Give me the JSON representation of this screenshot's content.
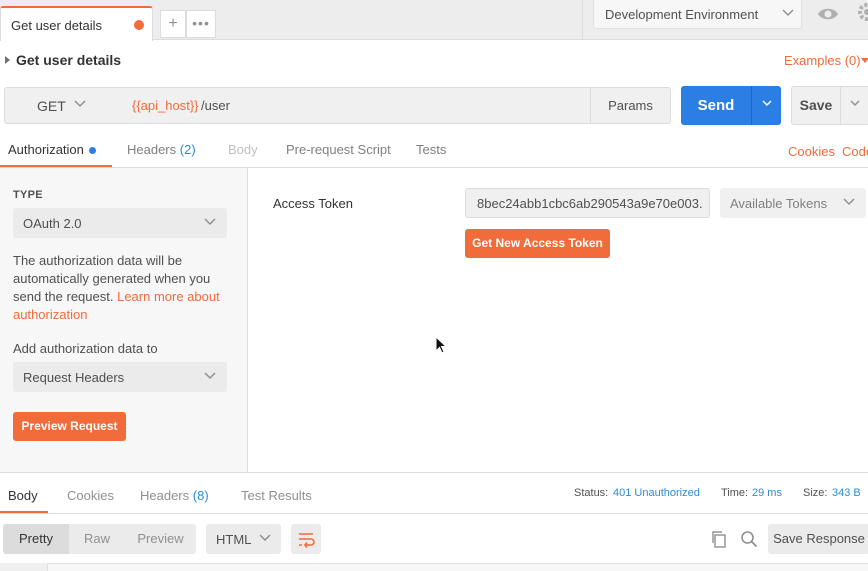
{
  "tabbar": {
    "active_tab": "Get user details",
    "plus": "+",
    "more": "•••",
    "environment": "Development Environment"
  },
  "request": {
    "title": "Get user details",
    "examples": "Examples (0)",
    "method": "GET",
    "url_variable": "{{api_host}}",
    "url_path": "/user",
    "params_label": "Params",
    "send_label": "Send",
    "save_label": "Save"
  },
  "request_tabs": {
    "authorization": "Authorization",
    "headers": "Headers",
    "headers_count": "(2)",
    "body": "Body",
    "prerequest": "Pre-request Script",
    "tests": "Tests",
    "cookies": "Cookies",
    "code": "Code"
  },
  "auth": {
    "type_label": "TYPE",
    "type_value": "OAuth 2.0",
    "description": "The authorization data will be automatically generated when you send the request.",
    "learn_more": "Learn more about authorization",
    "add_label": "Add authorization data to",
    "add_value": "Request Headers",
    "preview_button": "Preview Request",
    "token_label": "Access Token",
    "token_value": "8bec24abb1cbc6ab290543a9e70e003...",
    "available_tokens": "Available Tokens",
    "get_token_button": "Get New Access Token"
  },
  "response": {
    "tabs": {
      "body": "Body",
      "cookies": "Cookies",
      "headers": "Headers",
      "headers_count": "(8)",
      "test_results": "Test Results"
    },
    "status_label": "Status:",
    "status_value": "401 Unauthorized",
    "time_label": "Time:",
    "time_value": "29 ms",
    "size_label": "Size:",
    "size_value": "343 B",
    "views": {
      "pretty": "Pretty",
      "raw": "Raw",
      "preview": "Preview"
    },
    "format": "HTML",
    "save_response": "Save Response"
  },
  "colors": {
    "accent": "#f26b3a",
    "primary_button": "#2b7fe4",
    "link_blue": "#2a8dd4"
  }
}
